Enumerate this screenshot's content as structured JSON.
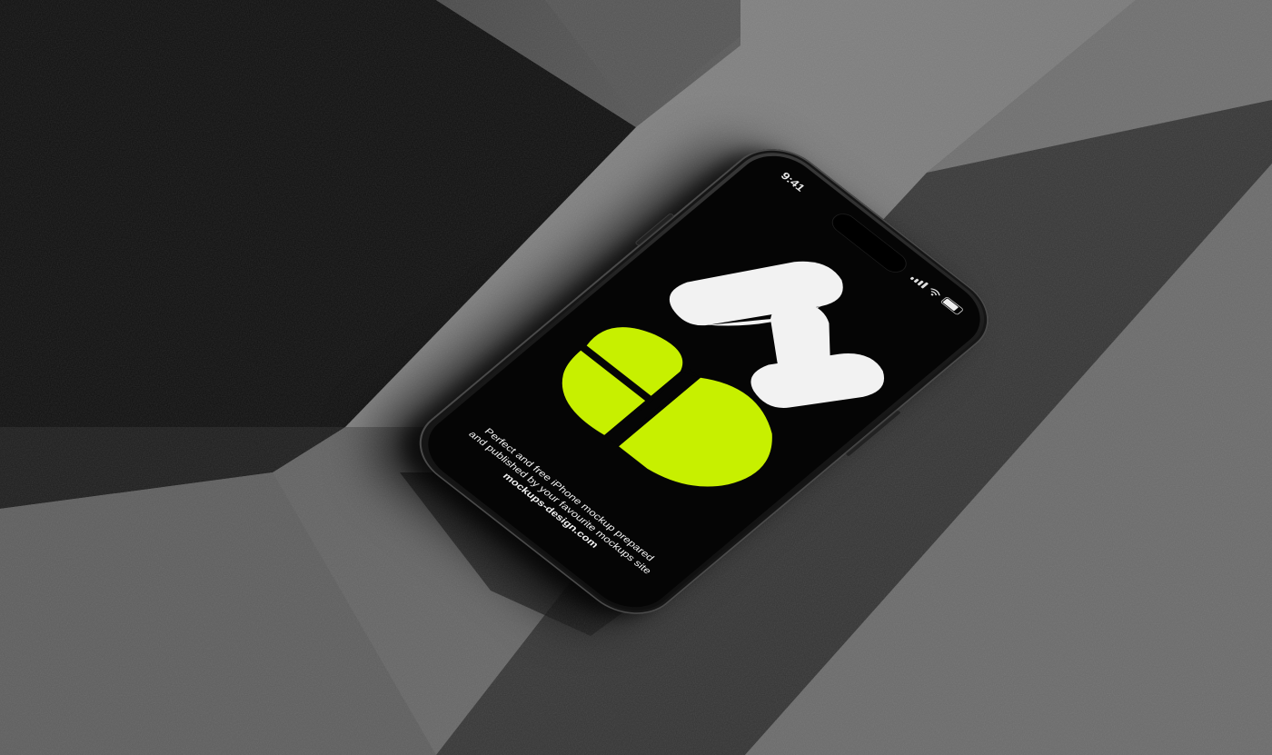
{
  "scene": {
    "description_colors": {
      "concrete_light": "#7b7b7b",
      "concrete_dark": "#3a3a3a",
      "shadow": "#0d0d0d",
      "accent_green": "#c7f000"
    }
  },
  "phone": {
    "status_time": "9:41",
    "icons": [
      "signal-icon",
      "wifi-icon",
      "battery-icon"
    ],
    "caption_line1": "Perfect and free iPhone mockup prepared",
    "caption_line2": "and published by your favourite mockups site",
    "caption_site": "mockups-design.com"
  }
}
